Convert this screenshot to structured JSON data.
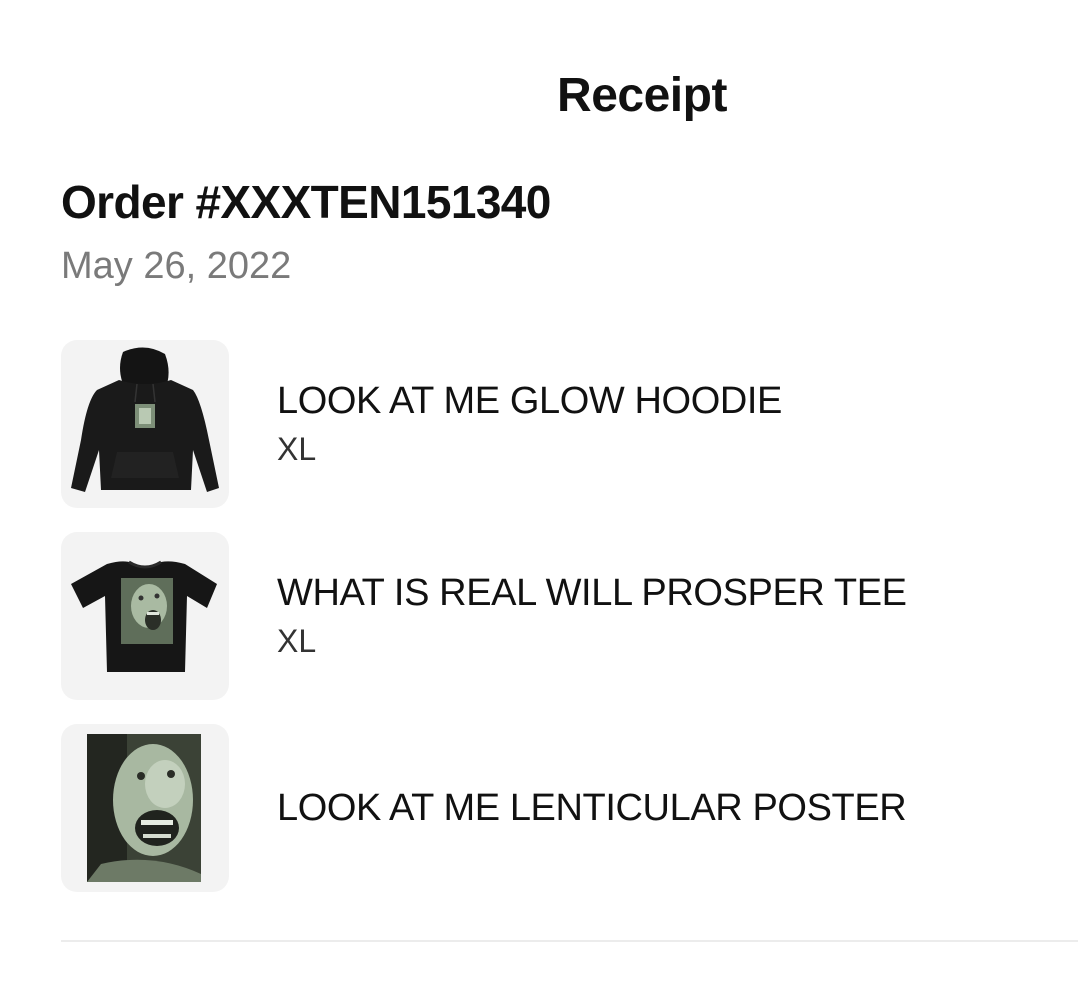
{
  "header": {
    "title": "Receipt"
  },
  "order": {
    "number": "Order #XXXTEN151340",
    "date": "May 26, 2022"
  },
  "items": [
    {
      "name": "LOOK AT ME GLOW HOODIE",
      "variant": "XL",
      "image_icon": "hoodie-product-image"
    },
    {
      "name": "WHAT IS REAL WILL PROSPER TEE",
      "variant": "XL",
      "image_icon": "tee-product-image"
    },
    {
      "name": "LOOK AT ME LENTICULAR POSTER",
      "variant": "",
      "image_icon": "poster-product-image"
    }
  ],
  "colors": {
    "text": "#111111",
    "secondary_text": "#7a7a7a",
    "thumb_background": "#f3f3f3",
    "divider": "#ececec",
    "glow_green": "#9fb59a"
  }
}
